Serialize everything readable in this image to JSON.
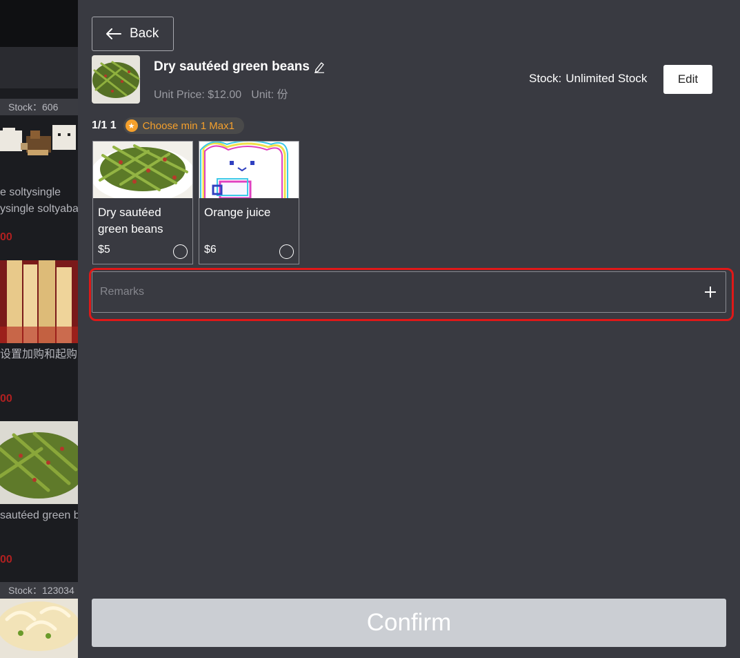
{
  "background_menu": {
    "items": [
      {
        "stock": "Stock：606",
        "name_line1": "e soltysingle",
        "name_line2": "ysingle soltyaba",
        "price": "00"
      },
      {
        "name_line1": "设置加购和起购",
        "price": "00"
      },
      {
        "name_line1": "sautéed green b",
        "price": "00"
      },
      {
        "stock": "Stock：123034"
      }
    ]
  },
  "panel": {
    "back_label": "Back",
    "product": {
      "title": "Dry sautéed green beans",
      "unit_price": "Unit Price: $12.00",
      "unit": "Unit: 份",
      "stock_label": "Stock:",
      "stock_value": "Unlimited Stock",
      "edit_label": "Edit"
    },
    "group": {
      "count": "1/1 1",
      "rule": "Choose min 1 Max1",
      "options": [
        {
          "name": "Dry sautéed green beans",
          "price": "$5",
          "selected": false
        },
        {
          "name": "Orange juice",
          "price": "$6",
          "selected": false
        }
      ]
    },
    "remarks": {
      "placeholder": "Remarks"
    },
    "confirm_label": "Confirm"
  },
  "colors": {
    "panel_bg": "#393a41",
    "accent_orange": "#f5a02c",
    "highlight_red": "#e01818",
    "confirm_bg": "#cbced3"
  }
}
